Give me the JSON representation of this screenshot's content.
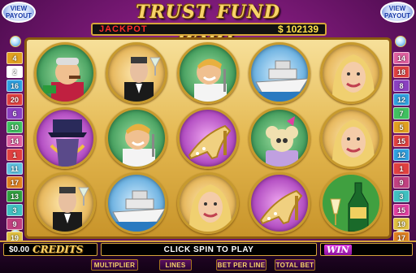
{
  "header": {
    "title": "TRUST FUND BABY",
    "view_payout_left": [
      "VIEW",
      "PAYOUT"
    ],
    "view_payout_right": [
      "VIEW",
      "PAYOUT"
    ]
  },
  "jackpot": {
    "label": "JACKPOT",
    "value": "$ 102139"
  },
  "paylines_left": [
    "4",
    "2",
    "16",
    "20",
    "6",
    "10",
    "14",
    "1",
    "11",
    "17",
    "13",
    "3",
    "9",
    "19",
    "5"
  ],
  "paylines_right": [
    "14",
    "18",
    "8",
    "12",
    "7",
    "5",
    "15",
    "12",
    "1",
    "9",
    "3",
    "15",
    "19",
    "17",
    "15"
  ],
  "paylines_left_colors": [
    "#e0a020",
    "#ffffff",
    "#30a0e0",
    "#e04040",
    "#8a40c0",
    "#40c060",
    "#e060a0",
    "#e04040",
    "#60c0e0",
    "#e08020",
    "#30a040",
    "#40c0c0",
    "#c04080",
    "#e0c040",
    "#e040a0"
  ],
  "paylines_right_colors": [
    "#e060a0",
    "#e04040",
    "#8a40c0",
    "#30a0e0",
    "#40c060",
    "#e0a020",
    "#e04040",
    "#30a0e0",
    "#e04040",
    "#c04080",
    "#40c0c0",
    "#e040a0",
    "#e0c040",
    "#e08020",
    "#e04040"
  ],
  "reels": [
    [
      "mogul",
      "butler",
      "playboy",
      "yacht",
      "blonde"
    ],
    [
      "tiara-jewels",
      "playboy",
      "stiletto",
      "poodle",
      "blonde"
    ],
    [
      "butler",
      "yacht",
      "blonde",
      "stiletto",
      "champagne"
    ]
  ],
  "reel_backgrounds": [
    [
      "d-green",
      "d-gold",
      "d-green",
      "d-blue",
      "d-gold"
    ],
    [
      "d-purple",
      "d-green",
      "d-purple",
      "d-green",
      "d-gold"
    ],
    [
      "d-gold",
      "d-blue",
      "d-gold",
      "d-purple",
      "d-gold"
    ]
  ],
  "footer": {
    "credit_amount": "$0.00",
    "credit_label": "CREDITS",
    "message": "CLICK SPIN TO PLAY",
    "win_label": "WIN",
    "controls": [
      "MULTIPLIER",
      "LINES",
      "BET PER LINE",
      "TOTAL BET"
    ]
  }
}
